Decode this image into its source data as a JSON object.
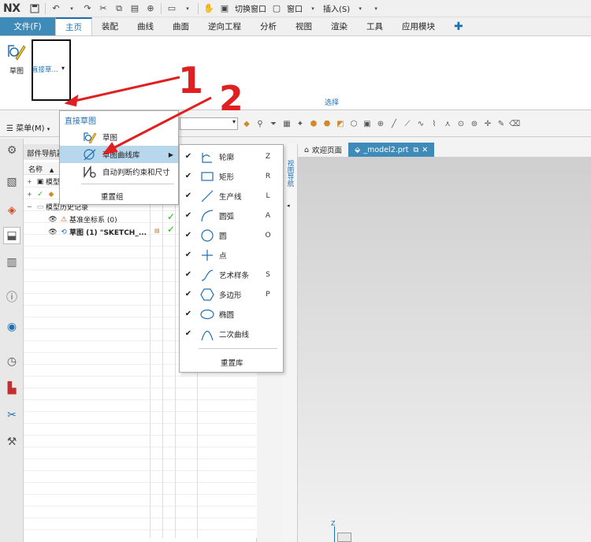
{
  "app": {
    "logo": "NX",
    "quick_access": {
      "switch_window": "切换窗口",
      "window": "窗口",
      "insert": "插入(S)"
    }
  },
  "tabs": [
    "文件(F)",
    "主页",
    "装配",
    "曲线",
    "曲面",
    "逆向工程",
    "分析",
    "视图",
    "渲染",
    "工具",
    "应用模块"
  ],
  "ribbon": {
    "sketch_label": "草图",
    "group_label": "直接草...",
    "select_label": "选择"
  },
  "toolbar2": {
    "menu_label": "菜单(M)"
  },
  "navigator": {
    "title": "部件导航器",
    "col_name": "名称",
    "rows": {
      "model_views": "模型",
      "history": "模型历史记录",
      "datum": "基准坐标系 (0)",
      "sketch": "草图 (1) \"SKETCH_..."
    }
  },
  "doc_tabs": {
    "welcome": "欢迎页面",
    "model": "_model2.prt"
  },
  "side_strip_text": "视图导航",
  "menu1": {
    "header": "直接草图",
    "items": [
      "草图",
      "草图曲线库",
      "自动判断约束和尺寸"
    ],
    "reset": "重置组"
  },
  "menu2": {
    "items": [
      {
        "label": "轮廓",
        "key": "Z"
      },
      {
        "label": "矩形",
        "key": "R"
      },
      {
        "label": "生产线",
        "key": "L"
      },
      {
        "label": "圆弧",
        "key": "A"
      },
      {
        "label": "圆",
        "key": "O"
      },
      {
        "label": "点",
        "key": ""
      },
      {
        "label": "艺术样条",
        "key": "S"
      },
      {
        "label": "多边形",
        "key": "P"
      },
      {
        "label": "椭圆",
        "key": ""
      },
      {
        "label": "二次曲线",
        "key": ""
      }
    ],
    "reset": "重置库"
  },
  "annotations": {
    "one": "1",
    "two": "2"
  },
  "axis": {
    "z": "Z"
  },
  "colors": {
    "accent": "#1f6fb2",
    "file_tab": "#3e8ab8",
    "highlight": "#b7d7ec",
    "annotation": "#e02020",
    "check": "#1db41d"
  }
}
